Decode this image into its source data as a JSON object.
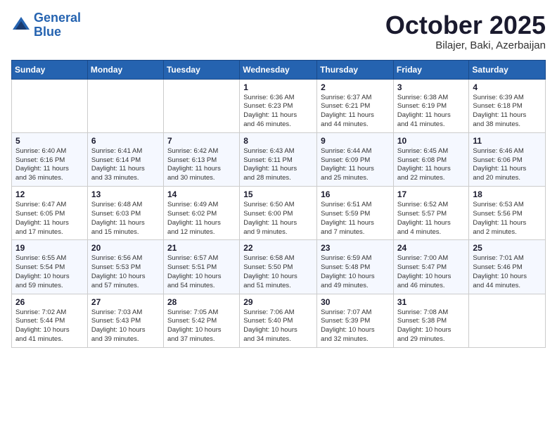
{
  "logo": {
    "line1": "General",
    "line2": "Blue"
  },
  "header": {
    "month": "October 2025",
    "location": "Bilajer, Baki, Azerbaijan"
  },
  "weekdays": [
    "Sunday",
    "Monday",
    "Tuesday",
    "Wednesday",
    "Thursday",
    "Friday",
    "Saturday"
  ],
  "weeks": [
    [
      {
        "day": "",
        "info": ""
      },
      {
        "day": "",
        "info": ""
      },
      {
        "day": "",
        "info": ""
      },
      {
        "day": "1",
        "info": "Sunrise: 6:36 AM\nSunset: 6:23 PM\nDaylight: 11 hours\nand 46 minutes."
      },
      {
        "day": "2",
        "info": "Sunrise: 6:37 AM\nSunset: 6:21 PM\nDaylight: 11 hours\nand 44 minutes."
      },
      {
        "day": "3",
        "info": "Sunrise: 6:38 AM\nSunset: 6:19 PM\nDaylight: 11 hours\nand 41 minutes."
      },
      {
        "day": "4",
        "info": "Sunrise: 6:39 AM\nSunset: 6:18 PM\nDaylight: 11 hours\nand 38 minutes."
      }
    ],
    [
      {
        "day": "5",
        "info": "Sunrise: 6:40 AM\nSunset: 6:16 PM\nDaylight: 11 hours\nand 36 minutes."
      },
      {
        "day": "6",
        "info": "Sunrise: 6:41 AM\nSunset: 6:14 PM\nDaylight: 11 hours\nand 33 minutes."
      },
      {
        "day": "7",
        "info": "Sunrise: 6:42 AM\nSunset: 6:13 PM\nDaylight: 11 hours\nand 30 minutes."
      },
      {
        "day": "8",
        "info": "Sunrise: 6:43 AM\nSunset: 6:11 PM\nDaylight: 11 hours\nand 28 minutes."
      },
      {
        "day": "9",
        "info": "Sunrise: 6:44 AM\nSunset: 6:09 PM\nDaylight: 11 hours\nand 25 minutes."
      },
      {
        "day": "10",
        "info": "Sunrise: 6:45 AM\nSunset: 6:08 PM\nDaylight: 11 hours\nand 22 minutes."
      },
      {
        "day": "11",
        "info": "Sunrise: 6:46 AM\nSunset: 6:06 PM\nDaylight: 11 hours\nand 20 minutes."
      }
    ],
    [
      {
        "day": "12",
        "info": "Sunrise: 6:47 AM\nSunset: 6:05 PM\nDaylight: 11 hours\nand 17 minutes."
      },
      {
        "day": "13",
        "info": "Sunrise: 6:48 AM\nSunset: 6:03 PM\nDaylight: 11 hours\nand 15 minutes."
      },
      {
        "day": "14",
        "info": "Sunrise: 6:49 AM\nSunset: 6:02 PM\nDaylight: 11 hours\nand 12 minutes."
      },
      {
        "day": "15",
        "info": "Sunrise: 6:50 AM\nSunset: 6:00 PM\nDaylight: 11 hours\nand 9 minutes."
      },
      {
        "day": "16",
        "info": "Sunrise: 6:51 AM\nSunset: 5:59 PM\nDaylight: 11 hours\nand 7 minutes."
      },
      {
        "day": "17",
        "info": "Sunrise: 6:52 AM\nSunset: 5:57 PM\nDaylight: 11 hours\nand 4 minutes."
      },
      {
        "day": "18",
        "info": "Sunrise: 6:53 AM\nSunset: 5:56 PM\nDaylight: 11 hours\nand 2 minutes."
      }
    ],
    [
      {
        "day": "19",
        "info": "Sunrise: 6:55 AM\nSunset: 5:54 PM\nDaylight: 10 hours\nand 59 minutes."
      },
      {
        "day": "20",
        "info": "Sunrise: 6:56 AM\nSunset: 5:53 PM\nDaylight: 10 hours\nand 57 minutes."
      },
      {
        "day": "21",
        "info": "Sunrise: 6:57 AM\nSunset: 5:51 PM\nDaylight: 10 hours\nand 54 minutes."
      },
      {
        "day": "22",
        "info": "Sunrise: 6:58 AM\nSunset: 5:50 PM\nDaylight: 10 hours\nand 51 minutes."
      },
      {
        "day": "23",
        "info": "Sunrise: 6:59 AM\nSunset: 5:48 PM\nDaylight: 10 hours\nand 49 minutes."
      },
      {
        "day": "24",
        "info": "Sunrise: 7:00 AM\nSunset: 5:47 PM\nDaylight: 10 hours\nand 46 minutes."
      },
      {
        "day": "25",
        "info": "Sunrise: 7:01 AM\nSunset: 5:46 PM\nDaylight: 10 hours\nand 44 minutes."
      }
    ],
    [
      {
        "day": "26",
        "info": "Sunrise: 7:02 AM\nSunset: 5:44 PM\nDaylight: 10 hours\nand 41 minutes."
      },
      {
        "day": "27",
        "info": "Sunrise: 7:03 AM\nSunset: 5:43 PM\nDaylight: 10 hours\nand 39 minutes."
      },
      {
        "day": "28",
        "info": "Sunrise: 7:05 AM\nSunset: 5:42 PM\nDaylight: 10 hours\nand 37 minutes."
      },
      {
        "day": "29",
        "info": "Sunrise: 7:06 AM\nSunset: 5:40 PM\nDaylight: 10 hours\nand 34 minutes."
      },
      {
        "day": "30",
        "info": "Sunrise: 7:07 AM\nSunset: 5:39 PM\nDaylight: 10 hours\nand 32 minutes."
      },
      {
        "day": "31",
        "info": "Sunrise: 7:08 AM\nSunset: 5:38 PM\nDaylight: 10 hours\nand 29 minutes."
      },
      {
        "day": "",
        "info": ""
      }
    ]
  ]
}
